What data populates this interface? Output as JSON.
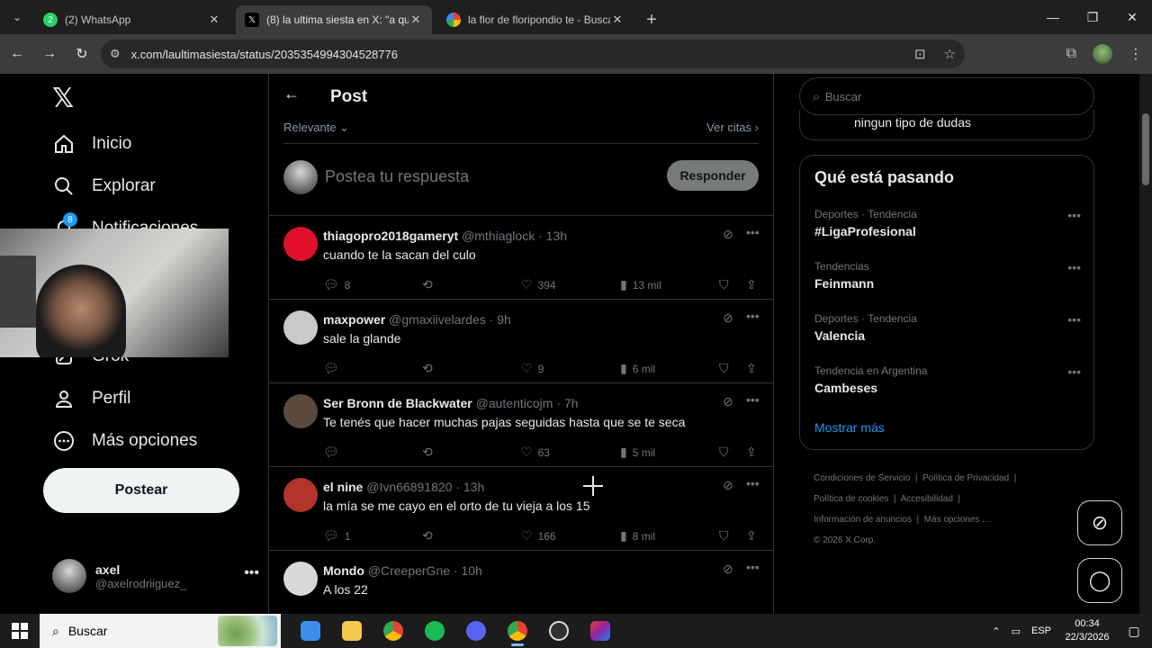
{
  "browser": {
    "tabs": [
      {
        "title": "(2) WhatsApp",
        "badge": "2",
        "active": false
      },
      {
        "title": "(8) la ultima siesta en X: \"a qué",
        "active": true
      },
      {
        "title": "la flor de floripondio te - Buscar",
        "active": false
      }
    ],
    "url": "x.com/laultimasiesta/status/2035354994304528776"
  },
  "leftnav": {
    "items": [
      {
        "label": "Inicio",
        "icon": "home-icon"
      },
      {
        "label": "Explorar",
        "icon": "search-icon"
      },
      {
        "label": "Notificaciones",
        "icon": "bell-icon"
      },
      {
        "label": "Grok",
        "icon": "grok-icon"
      },
      {
        "label": "Perfil",
        "icon": "person-icon"
      },
      {
        "label": "Más opciones",
        "icon": "more-circle-icon"
      }
    ],
    "notif_count": "8",
    "post_button": "Postear",
    "account": {
      "name": "axel",
      "handle": "@axelrodriiguez_"
    }
  },
  "main": {
    "title": "Post",
    "sort": "Relevante",
    "quotes": "Ver citas",
    "compose_placeholder": "Postea tu respuesta",
    "reply_button": "Responder",
    "replies": [
      {
        "name": "thiagopro2018gameryt",
        "handle": "@mthiaglock",
        "time": "13h",
        "text": "cuando te la sacan del culo",
        "replies": "8",
        "retweets": "",
        "likes": "394",
        "views": "13 mil",
        "avatar_color": "#e0102a"
      },
      {
        "name": "maxpower",
        "handle": "@gmaxiivelardes",
        "time": "9h",
        "text": "sale la glande",
        "replies": "",
        "retweets": "",
        "likes": "9",
        "views": "6 mil",
        "avatar_color": "#c9c9c9"
      },
      {
        "name": "Ser Bronn de Blackwater",
        "handle": "@autenticojm",
        "time": "7h",
        "text": "Te tenés que hacer muchas pajas seguidas hasta que se te seca",
        "replies": "",
        "retweets": "",
        "likes": "63",
        "views": "5 mil",
        "avatar_color": "#5a4a3e"
      },
      {
        "name": "el nine",
        "handle": "@Ivn66891820",
        "time": "13h",
        "text": "la mía se me cayo en el orto de tu vieja a los 15",
        "replies": "1",
        "retweets": "",
        "likes": "166",
        "views": "8 mil",
        "avatar_color": "#b3342a"
      },
      {
        "name": "Mondo",
        "handle": "@CreeperGne",
        "time": "10h",
        "text": "A los 22",
        "replies": "",
        "retweets": "",
        "likes": "",
        "views": "",
        "avatar_color": "#d8d8d8"
      }
    ]
  },
  "right": {
    "search_placeholder": "Buscar",
    "prev_card_text": "ningun tipo de dudas",
    "trends_title": "Qué está pasando",
    "trends": [
      {
        "category": "Deportes · Tendencia",
        "name": "#LigaProfesional"
      },
      {
        "category": "Tendencias",
        "name": "Feinmann"
      },
      {
        "category": "Deportes · Tendencia",
        "name": "Valencia"
      },
      {
        "category": "Tendencia en Argentina",
        "name": "Cambeses"
      }
    ],
    "show_more": "Mostrar más",
    "footer": [
      "Condiciones de Servicio",
      "Política de Privacidad",
      "Política de cookies",
      "Accesibilidad",
      "Información de anuncios",
      "Más opciones ...",
      "© 2026 X Corp."
    ]
  },
  "taskbar": {
    "search": "Buscar",
    "lang": "ESP",
    "time": "00:34",
    "date": "22/3/2026"
  }
}
